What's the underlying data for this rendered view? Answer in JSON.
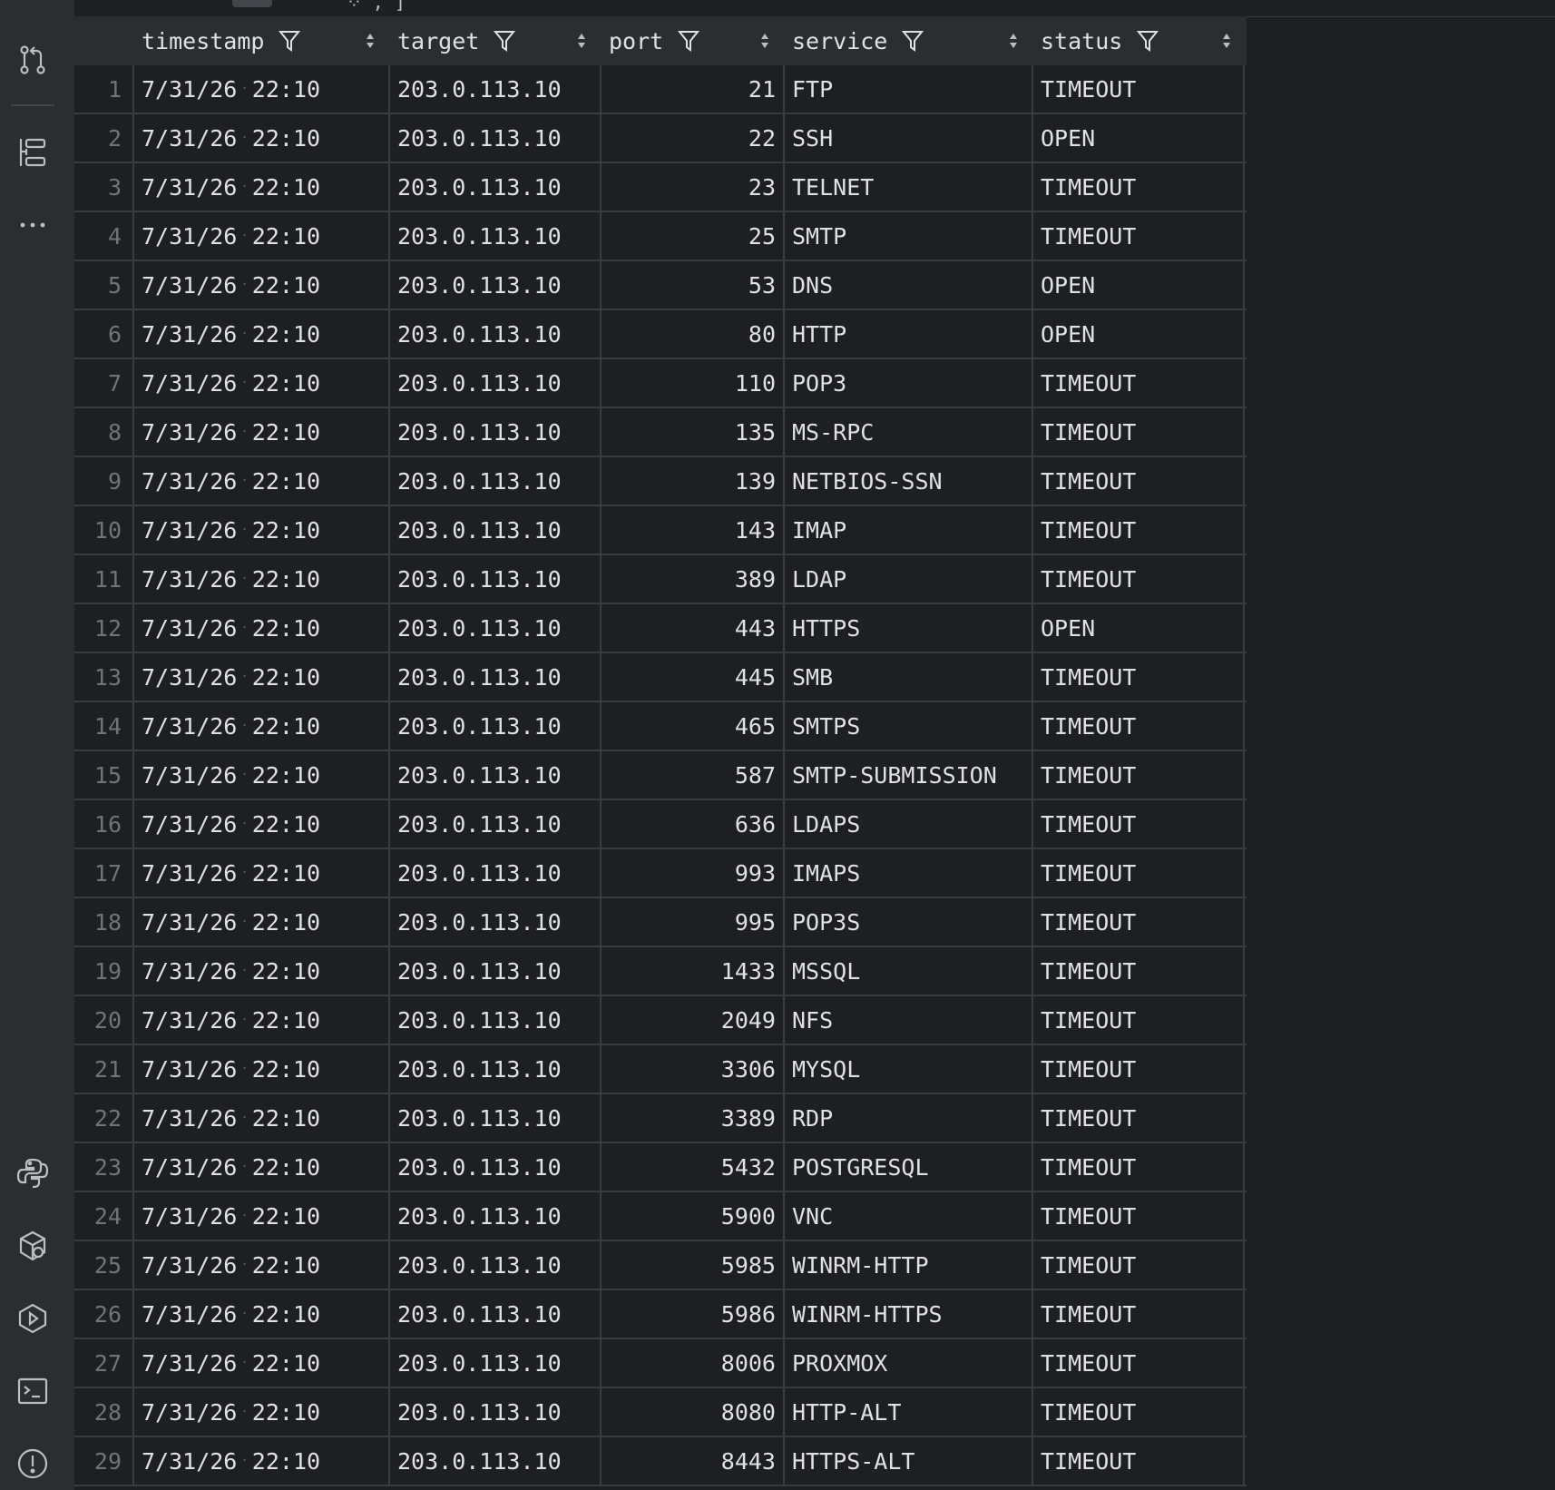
{
  "columns": {
    "timestamp": "timestamp",
    "target": "target",
    "port": "port",
    "service": "service",
    "status": "status"
  },
  "rows": [
    {
      "n": "1",
      "date": "7/31/26",
      "time": "22:10",
      "target": "203.0.113.10",
      "port": "21",
      "service": "FTP",
      "status": "TIMEOUT"
    },
    {
      "n": "2",
      "date": "7/31/26",
      "time": "22:10",
      "target": "203.0.113.10",
      "port": "22",
      "service": "SSH",
      "status": "OPEN"
    },
    {
      "n": "3",
      "date": "7/31/26",
      "time": "22:10",
      "target": "203.0.113.10",
      "port": "23",
      "service": "TELNET",
      "status": "TIMEOUT"
    },
    {
      "n": "4",
      "date": "7/31/26",
      "time": "22:10",
      "target": "203.0.113.10",
      "port": "25",
      "service": "SMTP",
      "status": "TIMEOUT"
    },
    {
      "n": "5",
      "date": "7/31/26",
      "time": "22:10",
      "target": "203.0.113.10",
      "port": "53",
      "service": "DNS",
      "status": "OPEN"
    },
    {
      "n": "6",
      "date": "7/31/26",
      "time": "22:10",
      "target": "203.0.113.10",
      "port": "80",
      "service": "HTTP",
      "status": "OPEN"
    },
    {
      "n": "7",
      "date": "7/31/26",
      "time": "22:10",
      "target": "203.0.113.10",
      "port": "110",
      "service": "POP3",
      "status": "TIMEOUT"
    },
    {
      "n": "8",
      "date": "7/31/26",
      "time": "22:10",
      "target": "203.0.113.10",
      "port": "135",
      "service": "MS-RPC",
      "status": "TIMEOUT"
    },
    {
      "n": "9",
      "date": "7/31/26",
      "time": "22:10",
      "target": "203.0.113.10",
      "port": "139",
      "service": "NETBIOS-SSN",
      "status": "TIMEOUT"
    },
    {
      "n": "10",
      "date": "7/31/26",
      "time": "22:10",
      "target": "203.0.113.10",
      "port": "143",
      "service": "IMAP",
      "status": "TIMEOUT"
    },
    {
      "n": "11",
      "date": "7/31/26",
      "time": "22:10",
      "target": "203.0.113.10",
      "port": "389",
      "service": "LDAP",
      "status": "TIMEOUT"
    },
    {
      "n": "12",
      "date": "7/31/26",
      "time": "22:10",
      "target": "203.0.113.10",
      "port": "443",
      "service": "HTTPS",
      "status": "OPEN"
    },
    {
      "n": "13",
      "date": "7/31/26",
      "time": "22:10",
      "target": "203.0.113.10",
      "port": "445",
      "service": "SMB",
      "status": "TIMEOUT"
    },
    {
      "n": "14",
      "date": "7/31/26",
      "time": "22:10",
      "target": "203.0.113.10",
      "port": "465",
      "service": "SMTPS",
      "status": "TIMEOUT"
    },
    {
      "n": "15",
      "date": "7/31/26",
      "time": "22:10",
      "target": "203.0.113.10",
      "port": "587",
      "service": "SMTP-SUBMISSION",
      "status": "TIMEOUT"
    },
    {
      "n": "16",
      "date": "7/31/26",
      "time": "22:10",
      "target": "203.0.113.10",
      "port": "636",
      "service": "LDAPS",
      "status": "TIMEOUT"
    },
    {
      "n": "17",
      "date": "7/31/26",
      "time": "22:10",
      "target": "203.0.113.10",
      "port": "993",
      "service": "IMAPS",
      "status": "TIMEOUT"
    },
    {
      "n": "18",
      "date": "7/31/26",
      "time": "22:10",
      "target": "203.0.113.10",
      "port": "995",
      "service": "POP3S",
      "status": "TIMEOUT"
    },
    {
      "n": "19",
      "date": "7/31/26",
      "time": "22:10",
      "target": "203.0.113.10",
      "port": "1433",
      "service": "MSSQL",
      "status": "TIMEOUT"
    },
    {
      "n": "20",
      "date": "7/31/26",
      "time": "22:10",
      "target": "203.0.113.10",
      "port": "2049",
      "service": "NFS",
      "status": "TIMEOUT"
    },
    {
      "n": "21",
      "date": "7/31/26",
      "time": "22:10",
      "target": "203.0.113.10",
      "port": "3306",
      "service": "MYSQL",
      "status": "TIMEOUT"
    },
    {
      "n": "22",
      "date": "7/31/26",
      "time": "22:10",
      "target": "203.0.113.10",
      "port": "3389",
      "service": "RDP",
      "status": "TIMEOUT"
    },
    {
      "n": "23",
      "date": "7/31/26",
      "time": "22:10",
      "target": "203.0.113.10",
      "port": "5432",
      "service": "POSTGRESQL",
      "status": "TIMEOUT"
    },
    {
      "n": "24",
      "date": "7/31/26",
      "time": "22:10",
      "target": "203.0.113.10",
      "port": "5900",
      "service": "VNC",
      "status": "TIMEOUT"
    },
    {
      "n": "25",
      "date": "7/31/26",
      "time": "22:10",
      "target": "203.0.113.10",
      "port": "5985",
      "service": "WINRM-HTTP",
      "status": "TIMEOUT"
    },
    {
      "n": "26",
      "date": "7/31/26",
      "time": "22:10",
      "target": "203.0.113.10",
      "port": "5986",
      "service": "WINRM-HTTPS",
      "status": "TIMEOUT"
    },
    {
      "n": "27",
      "date": "7/31/26",
      "time": "22:10",
      "target": "203.0.113.10",
      "port": "8006",
      "service": "PROXMOX",
      "status": "TIMEOUT"
    },
    {
      "n": "28",
      "date": "7/31/26",
      "time": "22:10",
      "target": "203.0.113.10",
      "port": "8080",
      "service": "HTTP-ALT",
      "status": "TIMEOUT"
    },
    {
      "n": "29",
      "date": "7/31/26",
      "time": "22:10",
      "target": "203.0.113.10",
      "port": "8443",
      "service": "HTTPS-ALT",
      "status": "TIMEOUT"
    }
  ],
  "sidebar_icons": [
    "git-pull-request-icon",
    "structure-icon",
    "more-icon",
    "python-console-icon",
    "python-packages-icon",
    "services-icon",
    "terminal-icon",
    "problems-icon"
  ],
  "colors": {
    "background": "#1e1f22",
    "sidebar": "#2b2d30",
    "header": "#2b2d30",
    "text": "#dfe1e5",
    "row_number": "#6f737a",
    "grid_line": "#393b40",
    "icon": "#bcbec4"
  }
}
